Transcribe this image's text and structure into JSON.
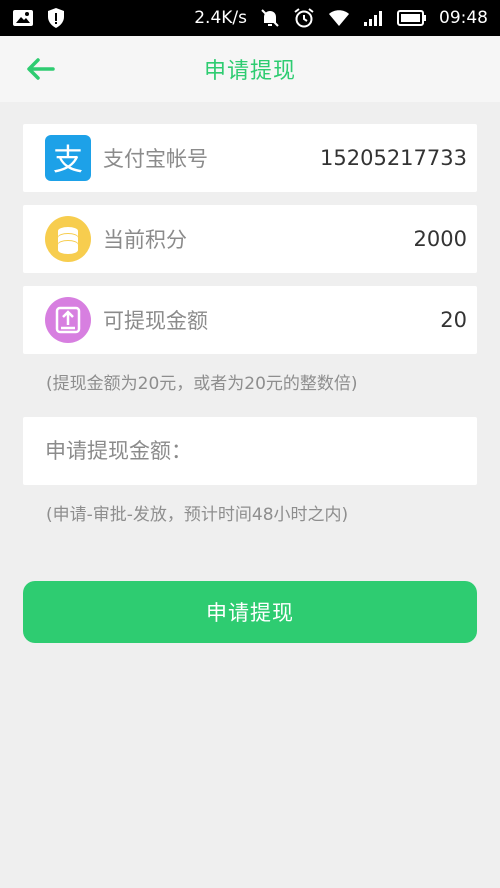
{
  "status_bar": {
    "speed": "2.4K/s",
    "time": "09:48"
  },
  "header": {
    "title": "申请提现",
    "back_icon": "arrow-left-icon"
  },
  "account": {
    "icon": "alipay-icon",
    "label": "支付宝帐号",
    "value": "15205217733"
  },
  "points": {
    "icon": "coins-icon",
    "label": "当前积分",
    "value": "2000"
  },
  "withdrawable": {
    "icon": "withdraw-icon",
    "label": "可提现金额",
    "value": "20"
  },
  "hint_amount": "(提现金额为20元，或者为20元的整数倍)",
  "amount_input": {
    "placeholder": "申请提现金额：",
    "value": ""
  },
  "hint_process": "(申请-审批-发放，预计时间48小时之内)",
  "submit": {
    "label": "申请提现"
  },
  "colors": {
    "accent": "#2ecc71",
    "alipay": "#1da1e8",
    "coin": "#f7cd4e",
    "withdraw": "#d77fe0"
  }
}
